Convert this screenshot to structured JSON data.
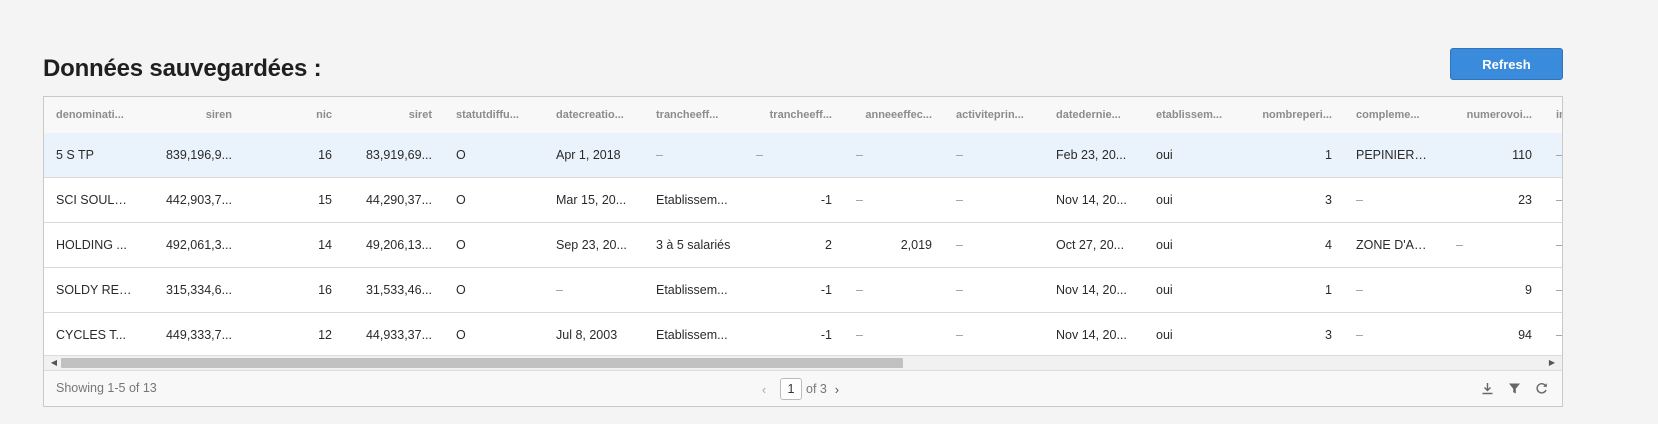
{
  "page": {
    "title": "Données sauvegardées :",
    "refresh_label": "Refresh"
  },
  "colors": {
    "accent": "#3a8bdb",
    "selected_row": "#eaf2fb"
  },
  "table": {
    "columns": [
      "denominati...",
      "siren",
      "nic",
      "siret",
      "statutdiffu...",
      "datecreatio...",
      "trancheeff...",
      "trancheeff...",
      "anneeeffec...",
      "activiteprin...",
      "datedernie...",
      "etablissem...",
      "nombreperi...",
      "compleme...",
      "numerovoi...",
      "in"
    ],
    "rows": [
      [
        "5 S TP",
        "839,196,9...",
        "16",
        "83,919,69...",
        "O",
        "Apr 1, 2018",
        "–",
        "–",
        "–",
        "–",
        "Feb 23, 20...",
        "oui",
        "1",
        "PEPINIERE ...",
        "110",
        "–"
      ],
      [
        "SCI SOULE...",
        "442,903,7...",
        "15",
        "44,290,37...",
        "O",
        "Mar 15, 20...",
        "Etablissem...",
        "-1",
        "–",
        "–",
        "Nov 14, 20...",
        "oui",
        "3",
        "–",
        "23",
        "–"
      ],
      [
        "HOLDING ...",
        "492,061,3...",
        "14",
        "49,206,13...",
        "O",
        "Sep 23, 20...",
        "3 à 5 salariés",
        "2",
        "2,019",
        "–",
        "Oct 27, 20...",
        "oui",
        "4",
        "ZONE D'AC...",
        "–",
        "–"
      ],
      [
        "SOLDY REI...",
        "315,334,6...",
        "16",
        "31,533,46...",
        "O",
        "–",
        "Etablissem...",
        "-1",
        "–",
        "–",
        "Nov 14, 20...",
        "oui",
        "1",
        "–",
        "9",
        "–"
      ],
      [
        "CYCLES T...",
        "449,333,7...",
        "12",
        "44,933,37...",
        "O",
        "Jul 8, 2003",
        "Etablissem...",
        "-1",
        "–",
        "–",
        "Nov 14, 20...",
        "oui",
        "3",
        "–",
        "94",
        "–"
      ]
    ],
    "selected_row": 0
  },
  "footer": {
    "showing": "Showing 1-5 of 13",
    "current_page": "1",
    "of_pages": "of 3",
    "tools": [
      "download-icon",
      "filter-icon",
      "reset-icon"
    ]
  }
}
